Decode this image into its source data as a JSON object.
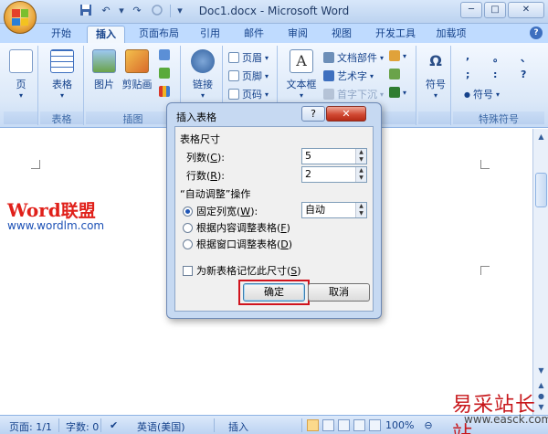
{
  "window": {
    "title": "Doc1.docx - Microsoft Word",
    "controls": {
      "minimize": "─",
      "maximize": "□",
      "close": "✕"
    }
  },
  "qat": {
    "save_icon": "save-icon",
    "undo": "↶",
    "redo": "↷",
    "customize": "▾"
  },
  "tabs": [
    {
      "label": "开始",
      "active": false
    },
    {
      "label": "插入",
      "active": true
    },
    {
      "label": "页面布局",
      "active": false
    },
    {
      "label": "引用",
      "active": false
    },
    {
      "label": "邮件",
      "active": false
    },
    {
      "label": "审阅",
      "active": false
    },
    {
      "label": "视图",
      "active": false
    },
    {
      "label": "开发工具",
      "active": false
    },
    {
      "label": "加载项",
      "active": false
    }
  ],
  "ribbon": {
    "pages": {
      "button": "页"
    },
    "tables": {
      "button": "表格",
      "group": "表格"
    },
    "illustrations": {
      "picture": "图片",
      "clipart": "剪贴画",
      "group": "插图"
    },
    "links": {
      "button": "链接"
    },
    "header_footer": {
      "header": "页眉",
      "footer": "页脚",
      "page_number": "页码"
    },
    "text": {
      "textbox": "文本框",
      "quickparts": "文档部件",
      "wordart": "艺术字",
      "dropcap": "首字下沉"
    },
    "symbols": {
      "button": "符号",
      "group": "特殊符号",
      "chars": [
        ",",
        "。",
        "、",
        ";",
        ":",
        "!",
        "?"
      ],
      "more": "符号"
    }
  },
  "document": {
    "logo_word": "Word",
    "logo_cn": "联盟",
    "logo_url": "www.wordlm.com",
    "watermark": "易采站长站",
    "watermark_url": "www.easck.com"
  },
  "statusbar": {
    "page": "页面: 1/1",
    "words": "字数: 0",
    "language": "英语(美国)",
    "mode": "插入",
    "zoom": "100%"
  },
  "dialog": {
    "title": "插入表格",
    "help": "?",
    "close": "✕",
    "size_section": "表格尺寸",
    "columns_label": "列数(",
    "columns_key": "C",
    "columns_suffix": "):",
    "columns_value": "5",
    "rows_label": "行数(",
    "rows_key": "R",
    "rows_suffix": "):",
    "rows_value": "2",
    "autofit_section": "“自动调整”操作",
    "fixed_label": "固定列宽(",
    "fixed_key": "W",
    "fixed_suffix": "):",
    "fixed_value": "自动",
    "content_label": "根据内容调整表格(",
    "content_key": "F",
    "content_suffix": ")",
    "window_label": "根据窗口调整表格(",
    "window_key": "D",
    "window_suffix": ")",
    "remember_label": "为新表格记忆此尺寸(",
    "remember_key": "S",
    "remember_suffix": ")",
    "ok": "确定",
    "cancel": "取消"
  }
}
